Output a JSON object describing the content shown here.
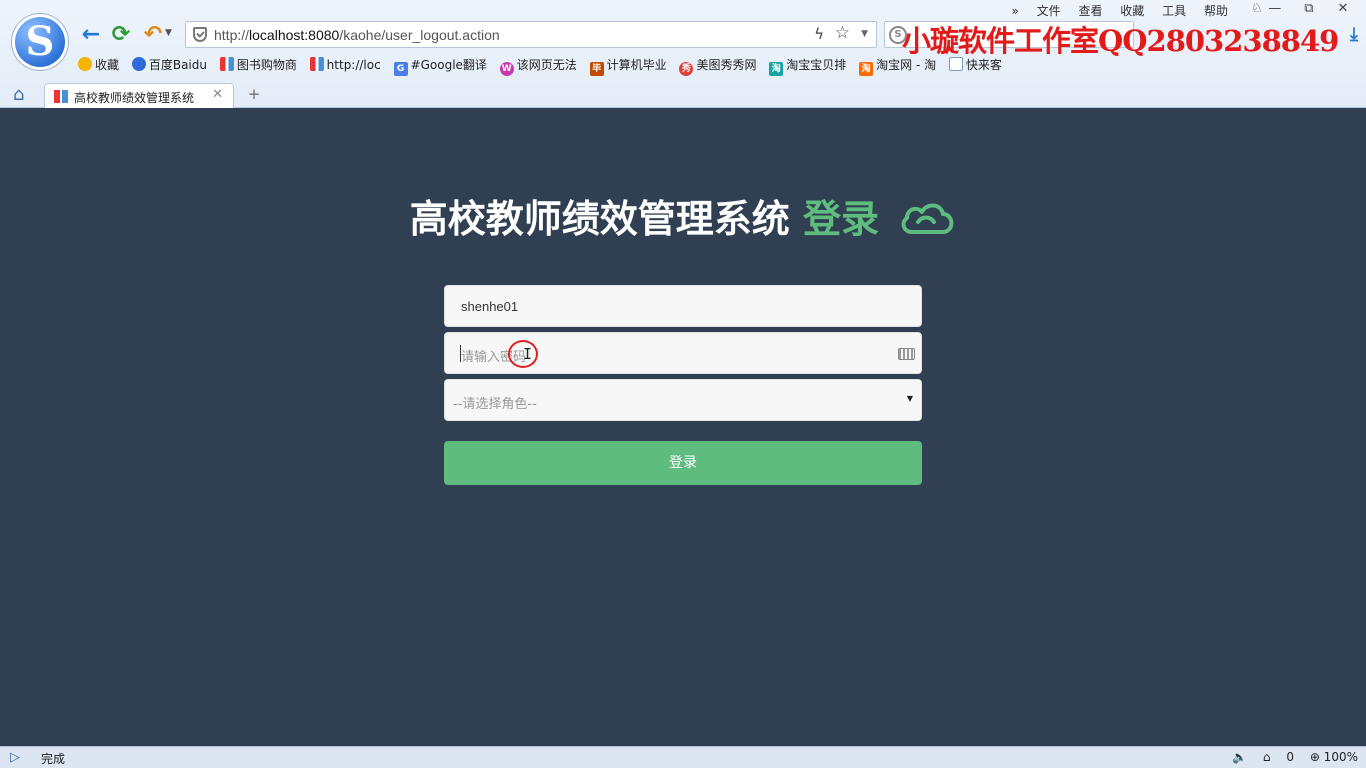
{
  "browser": {
    "logo_letter": "S",
    "address_prefix": "http://",
    "address_host": "localhost:8080",
    "address_path": "/kaohe/user_logout.action",
    "watermark": "小璇软件工作室QQ2803238849",
    "menus": [
      "»",
      "文件",
      "查看",
      "收藏",
      "工具",
      "帮助"
    ],
    "window_buttons": [
      "—",
      "⧉",
      "✕"
    ],
    "bookmarks": [
      {
        "label": "收藏",
        "icon": "star",
        "color": "#f4b400"
      },
      {
        "label": "百度Baidu",
        "icon": "paw",
        "color": "#2f6bd8"
      },
      {
        "label": "图书购物商",
        "icon": "bars",
        "color": "#e33"
      },
      {
        "label": "http://loc",
        "icon": "bars",
        "color": "#e33"
      },
      {
        "label": "#Google翻译",
        "icon": "G",
        "color": "#4a7fe5"
      },
      {
        "label": "该网页无法",
        "icon": "W",
        "color": "#c63ab0"
      },
      {
        "label": "计算机毕业",
        "icon": "毕",
        "color": "#c44b00"
      },
      {
        "label": "美图秀秀网",
        "icon": "秀",
        "color": "#e0403c"
      },
      {
        "label": "淘宝宝贝排",
        "icon": "淘",
        "color": "#1aa5a5"
      },
      {
        "label": "淘宝网 - 淘",
        "icon": "淘",
        "color": "#ff6a00"
      },
      {
        "label": "快来客",
        "icon": "doc",
        "color": "#7a9ac6"
      }
    ],
    "tab_title": "高校教师绩效管理系统",
    "tab_close": "✕",
    "new_tab": "+",
    "status_text": "完成",
    "status_right": [
      "🔈",
      "⌂",
      "0",
      "⊕ 100%"
    ]
  },
  "page": {
    "heading_main": "高校教师绩效管理系统",
    "heading_accent": "登录",
    "username_value": "shenhe01",
    "password_placeholder": "请输入密码",
    "role_placeholder": "--请选择角色--",
    "role_caret": "▼",
    "login_label": "登录",
    "accent_color": "#5ebd7e",
    "background_color": "#303f51"
  }
}
